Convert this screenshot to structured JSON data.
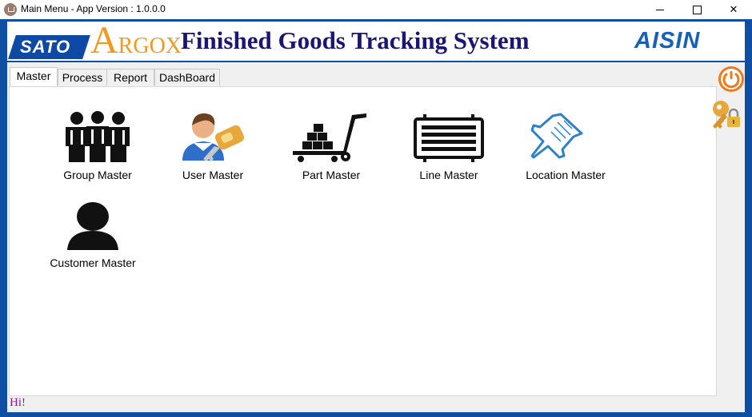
{
  "window": {
    "title": "Main Menu - App Version : 1.0.0.0",
    "close_glyph": "✕"
  },
  "header": {
    "logo_sato": "SATO",
    "logo_argox_big": "A",
    "logo_argox_small": "RGOX",
    "title": "Finished Goods Tracking System",
    "logo_aisin": "AISIN"
  },
  "tabs": [
    {
      "label": "Master",
      "active": true
    },
    {
      "label": "Process",
      "active": false
    },
    {
      "label": "Report",
      "active": false
    },
    {
      "label": "DashBoard",
      "active": false
    }
  ],
  "tiles": [
    {
      "label": "Group Master",
      "icon": "group-icon"
    },
    {
      "label": "User Master",
      "icon": "user-key-icon"
    },
    {
      "label": "Part Master",
      "icon": "hand-truck-icon"
    },
    {
      "label": "Line Master",
      "icon": "conveyor-line-icon"
    },
    {
      "label": "Location Master",
      "icon": "map-pin-icon"
    },
    {
      "label": "Customer Master",
      "icon": "customer-icon"
    }
  ],
  "side_icons": [
    "power-icon",
    "key-lock-icon"
  ],
  "status": {
    "text": "Hi!"
  },
  "colors": {
    "frame": "#0e4fa3",
    "brand_navy": "#1b1573",
    "argox_orange": "#f29a1d",
    "power_orange": "#f07a1a"
  }
}
